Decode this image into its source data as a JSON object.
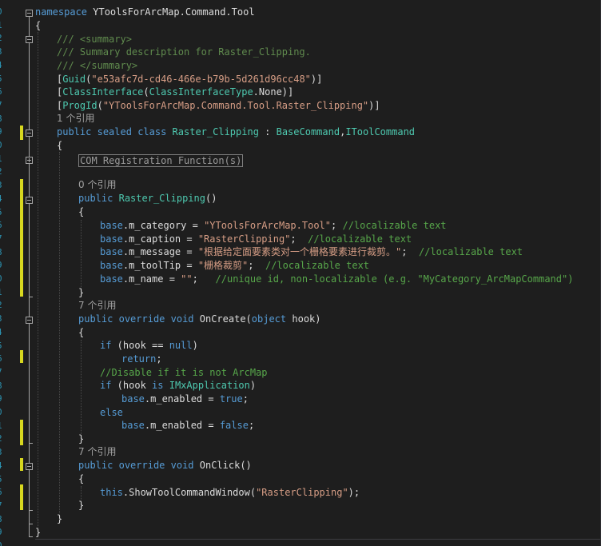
{
  "gutter": {
    "line_numbers": [
      "0",
      "1",
      "2",
      "3",
      "4",
      "5",
      "6",
      "7",
      "8",
      "9",
      "0",
      "1",
      "2",
      "3",
      "4",
      "5",
      "6",
      "7",
      "8",
      "9",
      "0",
      "1",
      "2",
      "3",
      "4",
      "5",
      "6",
      "7",
      "8",
      "9",
      "0",
      "1",
      "2",
      "3",
      "4",
      "5",
      "6",
      "7",
      "8",
      "9",
      "0"
    ]
  },
  "code": {
    "l1": {
      "kw": "namespace",
      "name": " YToolsForArcMap.Command.Tool"
    },
    "l2": {
      "text": "{"
    },
    "l3": {
      "text": "/// <summary>"
    },
    "l4": {
      "text": "/// Summary description for Raster_Clipping."
    },
    "l5": {
      "text": "/// </summary>"
    },
    "l6": {
      "open": "[",
      "attr": "Guid",
      "p1": "(",
      "str": "\"e53afc7d-cd46-466e-b79b-5d261d96cc48\"",
      "close": ")]"
    },
    "l7": {
      "open": "[",
      "attr": "ClassInterface",
      "p1": "(",
      "type": "ClassInterfaceType",
      "rest": ".None)]"
    },
    "l8": {
      "open": "[",
      "attr": "ProgId",
      "p1": "(",
      "str": "\"YToolsForArcMap.Command.Tool.Raster_Clipping\"",
      "close": ")]"
    },
    "l9": {
      "refs": "1 个引用"
    },
    "l10": {
      "kw1": "public",
      "kw2": "sealed",
      "kw3": "class",
      "name": "Raster_Clipping",
      "sep": " : ",
      "base": "BaseCommand",
      "comma": ",",
      "iface": "IToolCommand"
    },
    "l11": {
      "text": "{"
    },
    "l12": {
      "region": "COM Registration Function(s)"
    },
    "l13": {
      "refs": "0 个引用"
    },
    "l14": {
      "kw": "public",
      "name": "Raster_Clipping",
      "rest": "()"
    },
    "l15": {
      "text": "{"
    },
    "l16": {
      "kw": "base",
      "mid": ".m_category = ",
      "str": "\"YToolsForArcMap.Tool\"",
      "semi": "; ",
      "cm": "//localizable text"
    },
    "l17": {
      "kw": "base",
      "mid": ".m_caption = ",
      "str": "\"RasterClipping\"",
      "semi": ";  ",
      "cm": "//localizable text"
    },
    "l18": {
      "kw": "base",
      "mid": ".m_message = ",
      "str": "\"根据给定面要素类对一个栅格要素进行裁剪。\"",
      "semi": ";  ",
      "cm": "//localizable text"
    },
    "l19": {
      "kw": "base",
      "mid": ".m_toolTip = ",
      "str": "\"栅格裁剪\"",
      "semi": ";  ",
      "cm": "//localizable text"
    },
    "l20": {
      "kw": "base",
      "mid": ".m_name = ",
      "str": "\"\"",
      "semi": ";   ",
      "cm": "//unique id, non-localizable (e.g. \"MyCategory_ArcMapCommand\")"
    },
    "l21": {
      "text": "}"
    },
    "l22": {
      "refs": "7 个引用"
    },
    "l23": {
      "kw1": "public",
      "kw2": "override",
      "kw3": "void",
      "name": " OnCreate(",
      "kw4": "object",
      "rest": " hook)"
    },
    "l24": {
      "text": "{"
    },
    "l25": {
      "kw": "if",
      "a": " (hook == ",
      "kw2": "null",
      "b": ")"
    },
    "l26": {
      "kw": "return",
      "b": ";"
    },
    "l27": {
      "cm": "//Disable if it is not ArcMap"
    },
    "l28": {
      "kw": "if",
      "a": " (hook ",
      "kw2": "is",
      "sp": " ",
      "type": "IMxApplication",
      "b": ")"
    },
    "l29": {
      "kw": "base",
      "a": ".m_enabled = ",
      "kw2": "true",
      "b": ";"
    },
    "l30": {
      "kw": "else"
    },
    "l31": {
      "kw": "base",
      "a": ".m_enabled = ",
      "kw2": "false",
      "b": ";"
    },
    "l32": {
      "text": "}"
    },
    "l33": {
      "refs": "7 个引用"
    },
    "l34": {
      "kw1": "public",
      "kw2": "override",
      "kw3": "void",
      "rest": " OnClick()"
    },
    "l35": {
      "text": "{"
    },
    "l36": {
      "kw": "this",
      "a": ".ShowToolCommandWindow(",
      "str": "\"RasterClipping\"",
      "b": ");"
    },
    "l37": {
      "text": "}"
    },
    "l38": {
      "text": "}"
    },
    "l39": {
      "text": "}"
    }
  },
  "colors": {
    "background": "#1e1e1e",
    "keyword": "#569cd6",
    "type": "#4ec9b0",
    "string": "#d69d85",
    "comment": "#57a64a",
    "line_number": "#2b91af",
    "change_marker": "#d7d71f"
  }
}
